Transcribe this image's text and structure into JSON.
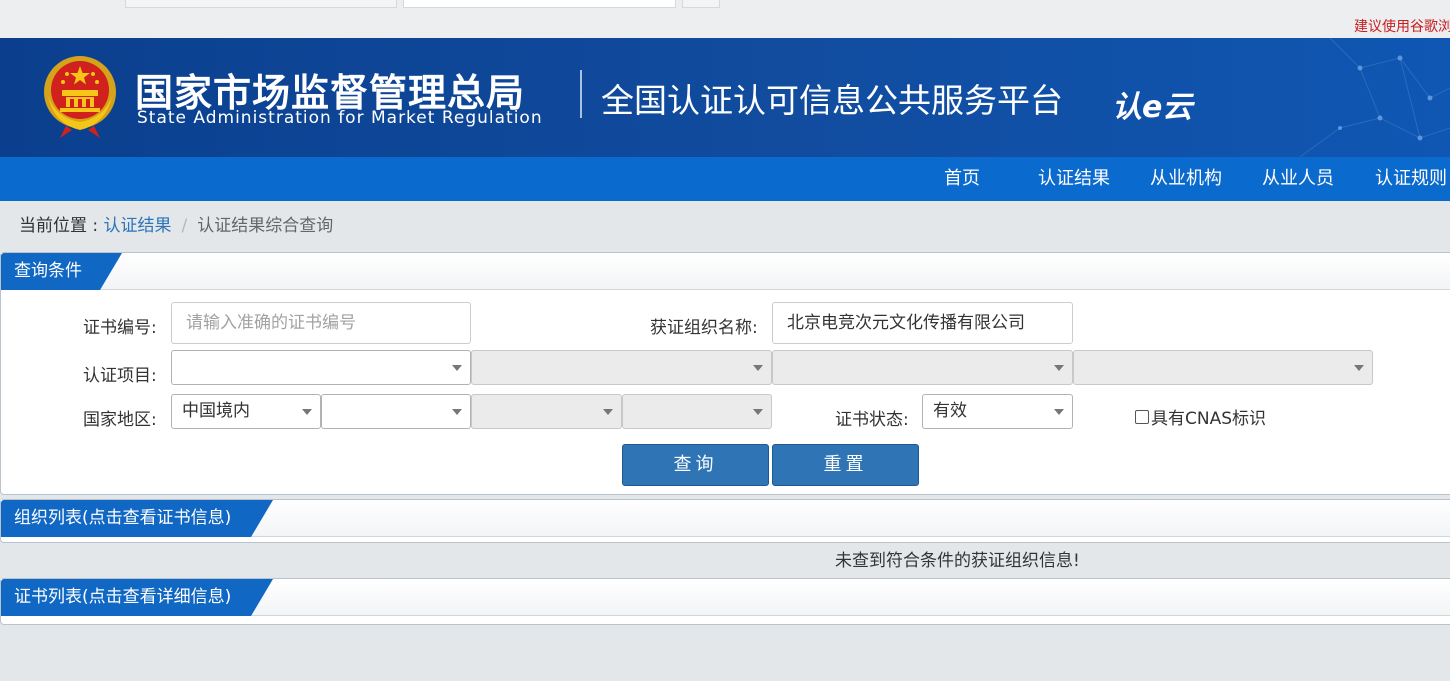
{
  "browser_tip": "建议使用谷歌浏",
  "header": {
    "org_cn": "国家市场监督管理总局",
    "org_en": "State Administration  for  Market Regulation",
    "platform_title": "全国认证认可信息公共服务平台",
    "platform_logo": "认e云"
  },
  "nav": {
    "items": [
      {
        "label": "首页"
      },
      {
        "label": "认证结果"
      },
      {
        "label": "从业机构"
      },
      {
        "label": "从业人员"
      },
      {
        "label": "认证规则"
      }
    ]
  },
  "breadcrumb": {
    "prefix": "当前位置 : ",
    "link": "认证结果",
    "separator": "/",
    "current": "认证结果综合查询"
  },
  "query_panel": {
    "title": "查询条件",
    "cert_no": {
      "label": "证书编号:",
      "placeholder": "请输入准确的证书编号",
      "value": ""
    },
    "org_name": {
      "label": "获证组织名称:",
      "value": "北京电竞次元文化传播有限公司"
    },
    "project": {
      "label": "认证项目:",
      "selects": [
        "",
        "",
        "",
        ""
      ]
    },
    "region": {
      "label": "国家地区:",
      "selects": [
        "中国境内",
        "",
        "",
        ""
      ]
    },
    "status": {
      "label": "证书状态:",
      "value": "有效"
    },
    "cnas_checkbox": {
      "label": "具有CNAS标识",
      "checked": false
    },
    "search_button": "查询",
    "reset_button": "重置"
  },
  "org_panel": {
    "title": "组织列表(点击查看证书信息)",
    "empty_message": "未查到符合条件的获证组织信息!"
  },
  "cert_panel": {
    "title": "证书列表(点击查看详细信息)"
  },
  "colors": {
    "banner": "#114c9f",
    "nav": "#0a6acd",
    "panel_tab": "#1068c4",
    "button": "#2f74b5",
    "link": "#2e74b8",
    "tip": "#c81e1e"
  }
}
